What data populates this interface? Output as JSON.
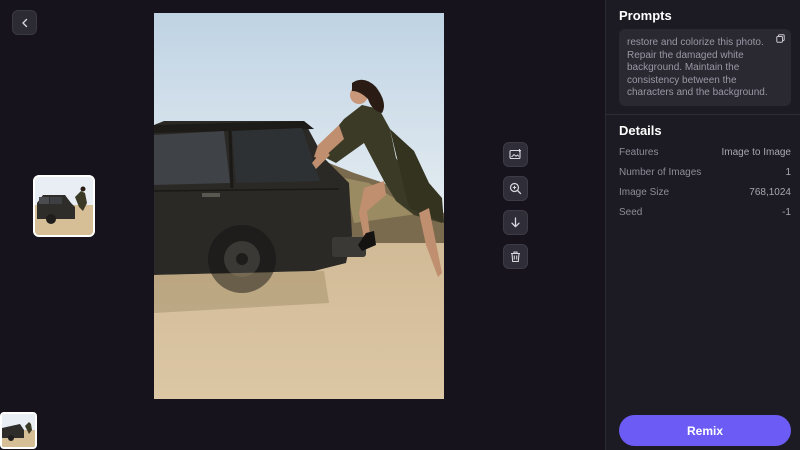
{
  "nav": {
    "back_icon": "chevron-left-icon"
  },
  "tools": [
    {
      "name": "add-image-icon"
    },
    {
      "name": "zoom-in-icon"
    },
    {
      "name": "download-icon"
    },
    {
      "name": "trash-icon"
    }
  ],
  "prompts": {
    "title": "Prompts",
    "text": "restore and colorize this photo. Repair the damaged white background. Maintain the consistency between the characters and the background.",
    "copy_icon": "copy-icon"
  },
  "details": {
    "title": "Details",
    "rows": [
      {
        "label": "Features",
        "value": "Image to Image"
      },
      {
        "label": "Number of Images",
        "value": "1"
      },
      {
        "label": "Image Size",
        "value": "768,1024"
      },
      {
        "label": "Seed",
        "value": "-1"
      }
    ]
  },
  "remix_label": "Remix",
  "colors": {
    "accent": "#6c5cf5",
    "background": "#16131c",
    "panel": "#1c1a22"
  }
}
